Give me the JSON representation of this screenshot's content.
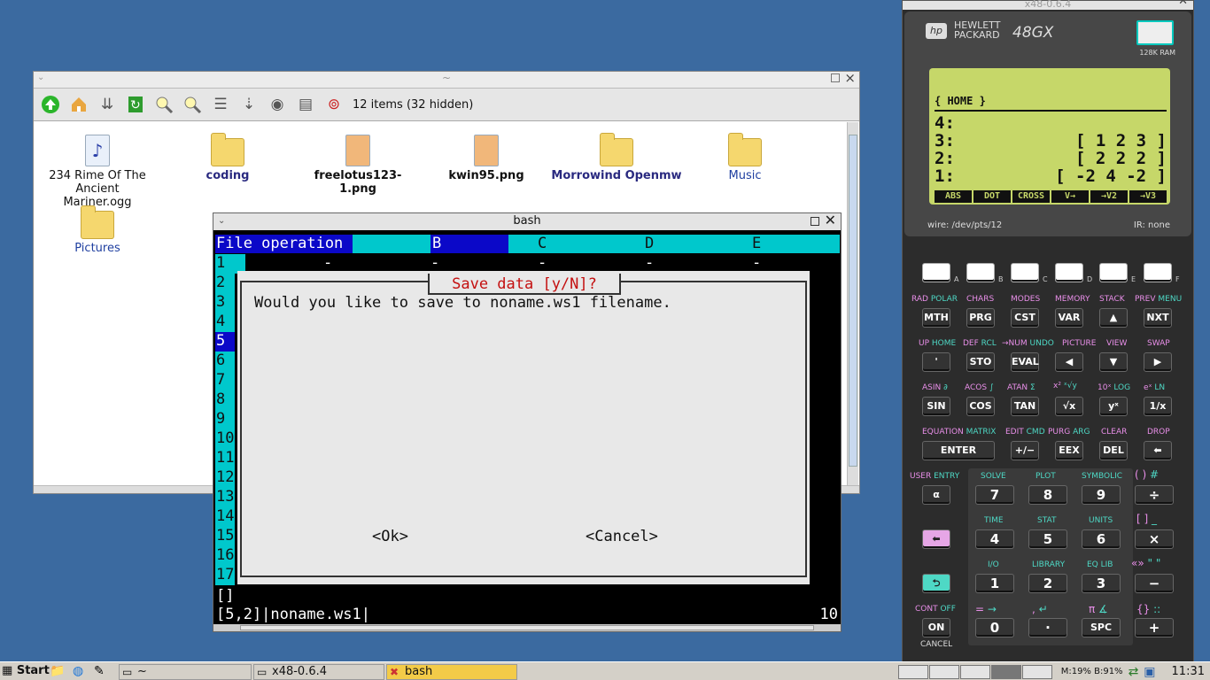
{
  "file_manager": {
    "title": "~",
    "item_count": "12 items (32 hidden)",
    "items": [
      {
        "name": "234 Rime Of The Ancient Mariner.ogg",
        "type": "audio"
      },
      {
        "name": "coding",
        "type": "folder"
      },
      {
        "name": "freelotus123-1.png",
        "type": "image"
      },
      {
        "name": "kwin95.png",
        "type": "image"
      },
      {
        "name": "Morrowind Openmw",
        "type": "folder"
      },
      {
        "name": "Music",
        "type": "folder"
      },
      {
        "name": "Pictures",
        "type": "folder"
      }
    ]
  },
  "terminal": {
    "title": "bash",
    "menu_label": "File operation",
    "columns": [
      "B",
      "C",
      "D",
      "E"
    ],
    "rows": [
      "1",
      "2",
      "3",
      "4",
      "5",
      "6",
      "7",
      "8",
      "9",
      "10",
      "11",
      "12",
      "13",
      "14",
      "15",
      "16",
      "17"
    ],
    "row1_cells": [
      "-",
      "-",
      "-",
      "-",
      "-"
    ],
    "cmd_line": "[]",
    "status": "[5,2]|noname.ws1|",
    "status_right": "10"
  },
  "dialog": {
    "title": "Save data [y/N]?",
    "message": "Would you like to save to noname.ws1 filename.",
    "ok": "<Ok>",
    "cancel": "<Cancel>"
  },
  "calculator": {
    "window_title": "x48-0.6.4",
    "brand_line1": "HEWLETT",
    "brand_line2": "PACKARD",
    "model": "48GX",
    "ram": "128K RAM",
    "screen": {
      "path": "{ HOME }",
      "stack": [
        {
          "level": "4:",
          "value": ""
        },
        {
          "level": "3:",
          "value": "[ 1 2 3 ]"
        },
        {
          "level": "2:",
          "value": "[ 2 2 2 ]"
        },
        {
          "level": "1:",
          "value": "[ -2 4 -2 ]"
        }
      ],
      "menu": [
        "ABS",
        "DOT",
        "CROSS",
        "V→",
        "→V2",
        "→V3"
      ]
    },
    "wire": "wire: /dev/pts/12",
    "ir": "IR: none"
  },
  "taskbar": {
    "start": "Start",
    "tasks": [
      {
        "label": "~",
        "active": false
      },
      {
        "label": "x48-0.6.4",
        "active": false
      },
      {
        "label": "bash",
        "active": true
      }
    ],
    "mem": "M:19% B:91%",
    "clock": "11:31"
  }
}
